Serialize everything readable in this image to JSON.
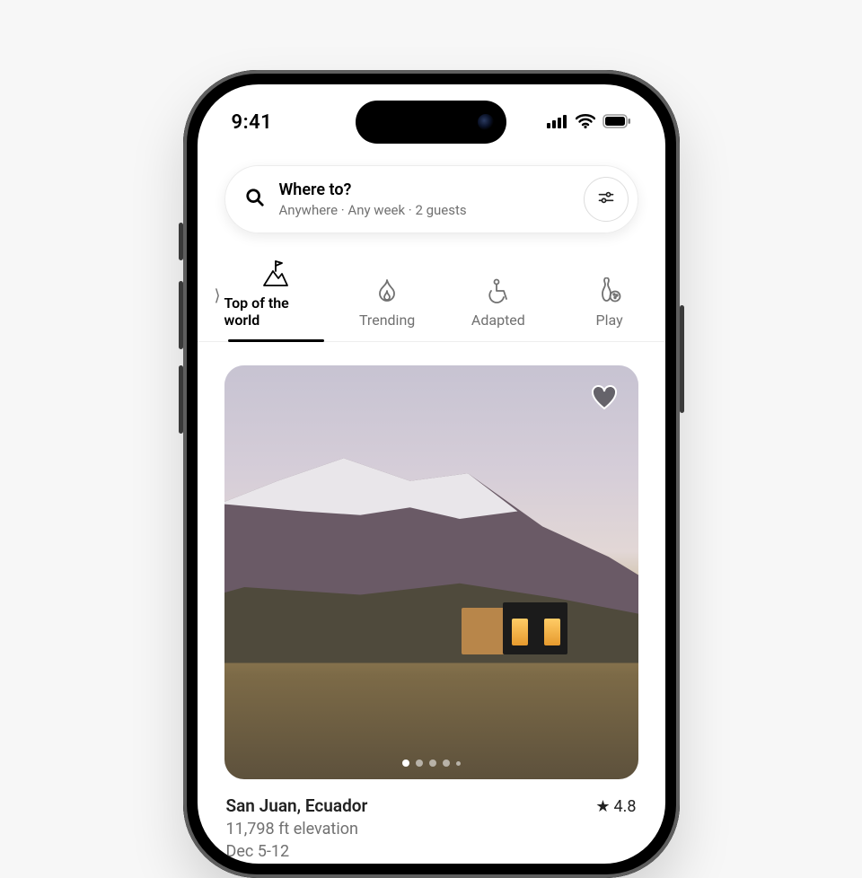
{
  "status": {
    "time": "9:41"
  },
  "search": {
    "title": "Where to?",
    "subtitle": "Anywhere · Any week · 2 guests"
  },
  "tabs": {
    "items": [
      {
        "label": "Top of the world",
        "active": true,
        "icon": "summit-flag-icon"
      },
      {
        "label": "Trending",
        "active": false,
        "icon": "flame-icon"
      },
      {
        "label": "Adapted",
        "active": false,
        "icon": "wheelchair-icon"
      },
      {
        "label": "Play",
        "active": false,
        "icon": "bowling-icon"
      }
    ]
  },
  "listing": {
    "title": "San Juan, Ecuador",
    "line2": "11,798 ft elevation",
    "line3": "Dec 5-12",
    "rating": "4.8",
    "carousel": {
      "count": 5,
      "active": 0
    }
  }
}
